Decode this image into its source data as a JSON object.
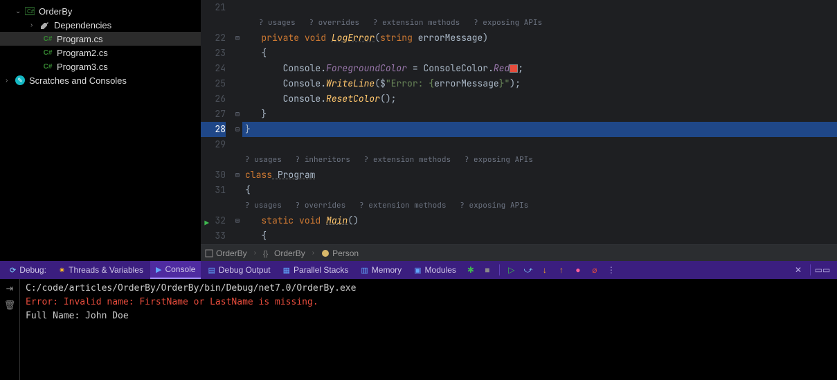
{
  "sidebar": {
    "project_name": "OrderBy",
    "dependencies": "Dependencies",
    "files": [
      "Program.cs",
      "Program2.cs",
      "Program3.cs"
    ],
    "scratches": "Scratches and Consoles"
  },
  "editor": {
    "lines": {
      "l21": "21",
      "l22": "22",
      "l23": "23",
      "l24": "24",
      "l25": "25",
      "l26": "26",
      "l27": "27",
      "l28": "28",
      "l29": "29",
      "l30": "30",
      "l31": "31",
      "l32": "32",
      "l33": "33"
    },
    "hints": {
      "usages": "? usages",
      "overrides": "? overrides",
      "ext_methods": "? extension methods",
      "exposing": "? exposing APIs",
      "inheritors": "? inheritors"
    },
    "code": {
      "private": "private",
      "void": "void",
      "logerror": "LogError",
      "sig_open": "(",
      "string": "string",
      "errmsg": " errorMessage)",
      "brace_open": "{",
      "brace_close": "}",
      "console": "Console",
      "fgcolor": "ForegroundColor",
      "eq": " = ",
      "consolecolor": "ConsoleColor",
      "red": "Red",
      "semi": ";",
      "writeline": "WriteLine",
      "dollar": "$",
      "strbegin": "\"Error: {",
      "errorMessage": "errorMessage",
      "strend": "}\"",
      "paren_open": "(",
      "paren_close": ")",
      "resetcolor": "ResetColor",
      "class_kw": "class",
      "program": " Program",
      "static": "static",
      "main": "Main",
      "dot": "."
    }
  },
  "breadcrumb": {
    "item1": "OrderBy",
    "item2": "OrderBy",
    "item3": "Person"
  },
  "debug_tabs": {
    "debug": "Debug:",
    "threads": "Threads & Variables",
    "console": "Console",
    "debug_output": "Debug Output",
    "parallel": "Parallel Stacks",
    "memory": "Memory",
    "modules": "Modules"
  },
  "console": {
    "line1": "C:/code/articles/OrderBy/OrderBy/bin/Debug/net7.0/OrderBy.exe",
    "line2": "Error: Invalid name: FirstName or LastName is missing.",
    "line3": "Full Name: John Doe"
  }
}
